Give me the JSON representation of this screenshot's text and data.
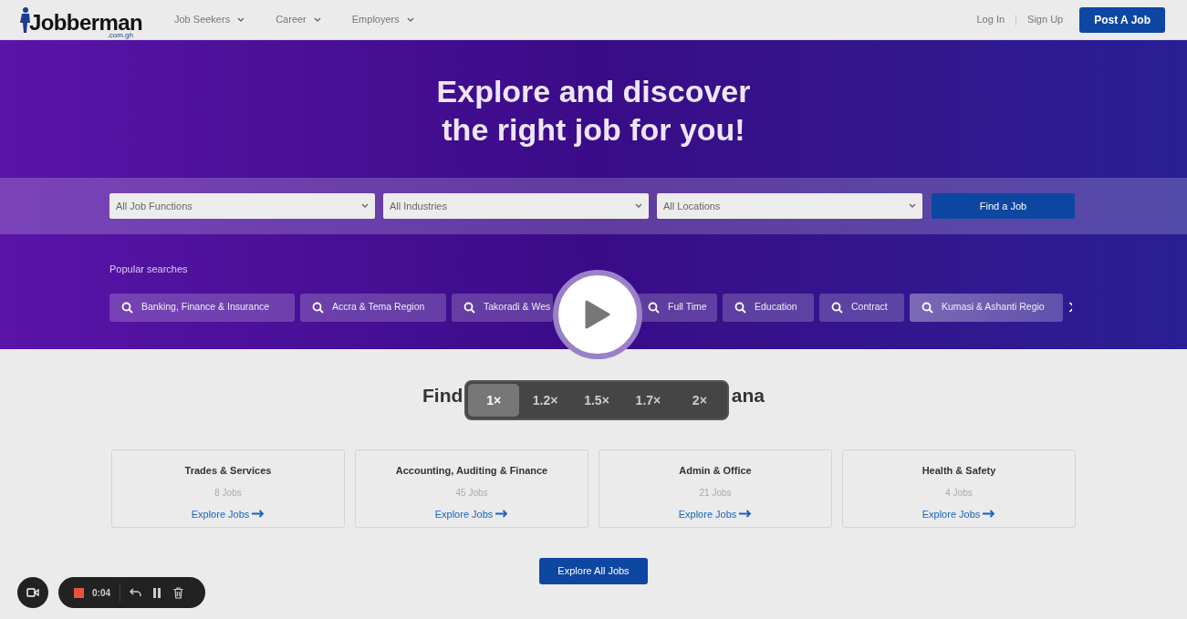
{
  "nav": {
    "logo": "Jobberman",
    "logo_suffix": ".com.gh",
    "menus": [
      "Job Seekers",
      "Career",
      "Employers"
    ],
    "links": [
      "Log In",
      "Sign Up"
    ],
    "cta": "Post A Job"
  },
  "hero": {
    "title_lines": [
      "Explore and discover",
      "the right job for you!"
    ],
    "filters": [
      {
        "placeholder": "All Job Functions"
      },
      {
        "placeholder": "All Industries"
      },
      {
        "placeholder": "All Locations"
      }
    ],
    "search_button": "Find a Job",
    "popular_label": "Popular searches",
    "chips": [
      "Banking, Finance & Insurance",
      "Accra & Tema Region",
      "Takoradi & Wes",
      "Full Time",
      "Education",
      "Contract",
      "Kumasi & Ashanti Regio"
    ]
  },
  "section": {
    "title_visible_parts": [
      "Find",
      "ana"
    ],
    "cards": [
      {
        "title": "Trades & Services",
        "count": "8 Jobs",
        "link": "Explore Jobs"
      },
      {
        "title": "Accounting, Auditing & Finance",
        "count": "45 Jobs",
        "link": "Explore Jobs"
      },
      {
        "title": "Admin & Office",
        "count": "21 Jobs",
        "link": "Explore Jobs"
      },
      {
        "title": "Health & Safety",
        "count": "4 Jobs",
        "link": "Explore Jobs"
      }
    ],
    "all_button": "Explore All Jobs"
  },
  "player": {
    "speeds": [
      {
        "label": "1×",
        "selected": true
      },
      {
        "label": "1.2×",
        "selected": false
      },
      {
        "label": "1.5×",
        "selected": false
      },
      {
        "label": "1.7×",
        "selected": false
      },
      {
        "label": "2×",
        "selected": false
      }
    ],
    "timer": "0:04"
  }
}
